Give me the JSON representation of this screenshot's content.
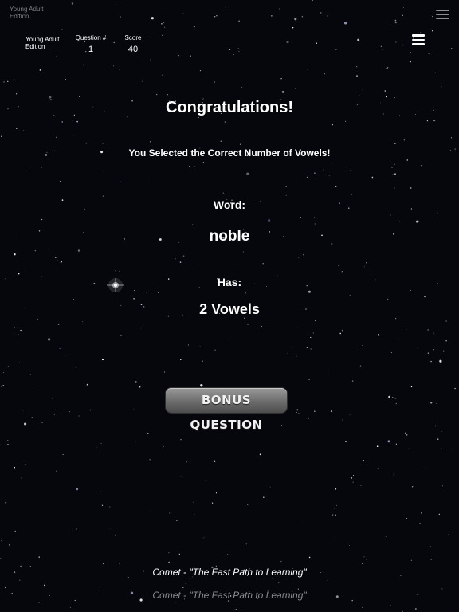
{
  "ghost": {
    "edition_line1": "Young Adult",
    "edition_line2": "Edition",
    "menu_icon": "hamburger-menu-icon"
  },
  "header": {
    "edition_line1": "Young Adult",
    "edition_line2": "Edition",
    "question_label": "Question #",
    "question_value": "1",
    "score_label": "Score",
    "score_value": "40",
    "menu_icon": "hamburger-menu-icon"
  },
  "result": {
    "title": "Congratulations!",
    "message": "You Selected the Correct Number of Vowels!",
    "word_label": "Word:",
    "word": "noble",
    "has_label": "Has:",
    "vowel_count": "2 Vowels"
  },
  "bonus_button": {
    "label": "BONUS QUESTION"
  },
  "footer": {
    "tagline": "Comet - \"The Fast Path to Learning\"",
    "tagline_ghost": "Comet - \"The Fast Path to Learning\""
  },
  "colors": {
    "background": "#05070d",
    "text": "#ffffff",
    "ghost_text": "#8a8c92",
    "button_top": "#9a9a9a",
    "button_bottom": "#4d4d4d"
  }
}
